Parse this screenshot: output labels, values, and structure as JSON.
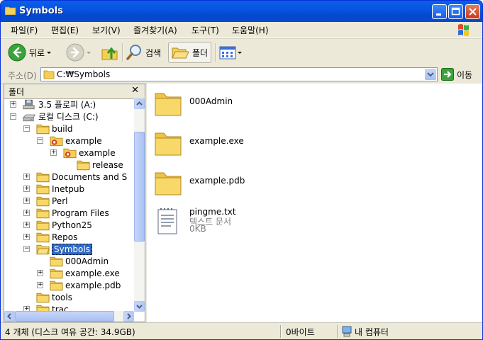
{
  "window": {
    "title": "Symbols"
  },
  "menu": [
    "파일(F)",
    "편집(E)",
    "보기(V)",
    "즐겨찾기(A)",
    "도구(T)",
    "도움말(H)"
  ],
  "toolbar": {
    "back_label": "뒤로",
    "search_label": "검색",
    "folders_label": "폴더"
  },
  "address": {
    "label": "주소(D)",
    "value": "C:₩Symbols",
    "go_label": "이동"
  },
  "folder_pane": {
    "title": "폴더",
    "close_glyph": "✕"
  },
  "tree": [
    {
      "label": "3.5 플로피 (A:)",
      "icon": "floppy-icon",
      "expander": "+"
    },
    {
      "label": "로컬 디스크 (C:)",
      "icon": "drive-icon",
      "expander": "−"
    },
    {
      "label": "build",
      "icon": "folder-icon",
      "expander": "−"
    },
    {
      "label": "example",
      "icon": "shared-folder-icon",
      "expander": "−"
    },
    {
      "label": "example",
      "icon": "shared-folder-icon",
      "expander": "+"
    },
    {
      "label": "release",
      "icon": "folder-icon",
      "expander": ""
    },
    {
      "label": "Documents and S",
      "icon": "folder-icon",
      "expander": "+"
    },
    {
      "label": "Inetpub",
      "icon": "folder-icon",
      "expander": "+"
    },
    {
      "label": "Perl",
      "icon": "folder-icon",
      "expander": "+"
    },
    {
      "label": "Program Files",
      "icon": "folder-icon",
      "expander": "+"
    },
    {
      "label": "Python25",
      "icon": "folder-icon",
      "expander": "+"
    },
    {
      "label": "Repos",
      "icon": "folder-icon",
      "expander": "+"
    },
    {
      "label": "Symbols",
      "icon": "open-folder-icon",
      "expander": "−",
      "selected": true
    },
    {
      "label": "000Admin",
      "icon": "folder-icon",
      "expander": ""
    },
    {
      "label": "example.exe",
      "icon": "folder-icon",
      "expander": "+"
    },
    {
      "label": "example.pdb",
      "icon": "folder-icon",
      "expander": "+"
    },
    {
      "label": "tools",
      "icon": "folder-icon",
      "expander": ""
    },
    {
      "label": "trac",
      "icon": "folder-icon",
      "expander": "+"
    }
  ],
  "files": [
    {
      "name": "000Admin",
      "icon": "folder-icon"
    },
    {
      "name": "example.exe",
      "icon": "folder-icon"
    },
    {
      "name": "example.pdb",
      "icon": "folder-icon"
    },
    {
      "name": "pingme.txt",
      "icon": "text-file-icon",
      "type": "텍스트 문서",
      "size": "0KB"
    }
  ],
  "status": {
    "objects": "4 개체 (디스크 여유 공간: 34.9GB)",
    "size": "0바이트",
    "location": "내 컴퓨터"
  }
}
